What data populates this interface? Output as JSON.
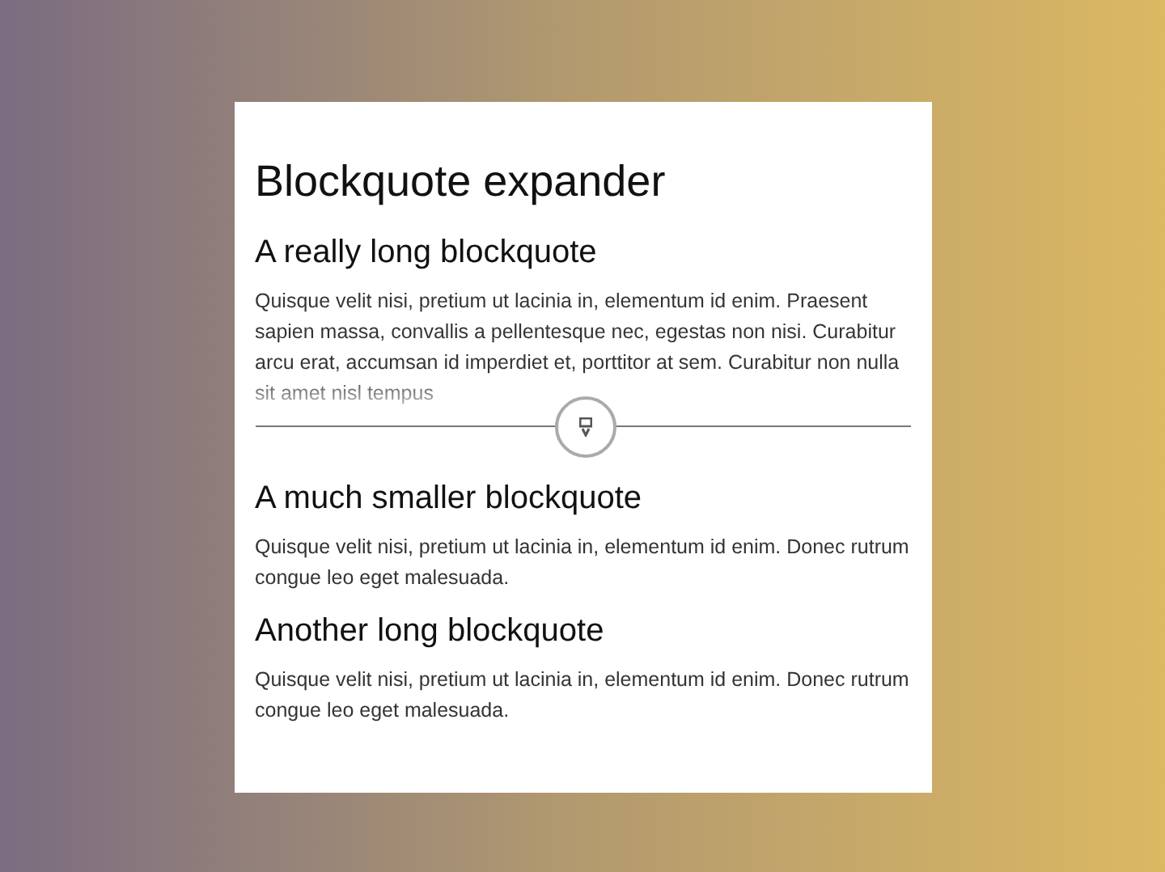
{
  "title": "Blockquote expander",
  "sections": [
    {
      "heading": "A really long blockquote",
      "quote": "Quisque velit nisi, pretium ut lacinia in, elementum id enim. Praesent sapien massa, convallis a pellentesque nec, egestas non nisi. Curabitur arcu erat, accumsan id imperdiet et, porttitor at sem. Curabitur non nulla sit amet nisl tempus",
      "expanded": false
    },
    {
      "heading": "A much smaller blockquote",
      "quote": "Quisque velit nisi, pretium ut lacinia in, elementum id enim. Donec rutrum congue leo eget malesuada."
    },
    {
      "heading": "Another long blockquote",
      "quote": "Quisque velit nisi, pretium ut lacinia in, elementum id enim. Donec rutrum congue leo eget malesuada."
    }
  ]
}
